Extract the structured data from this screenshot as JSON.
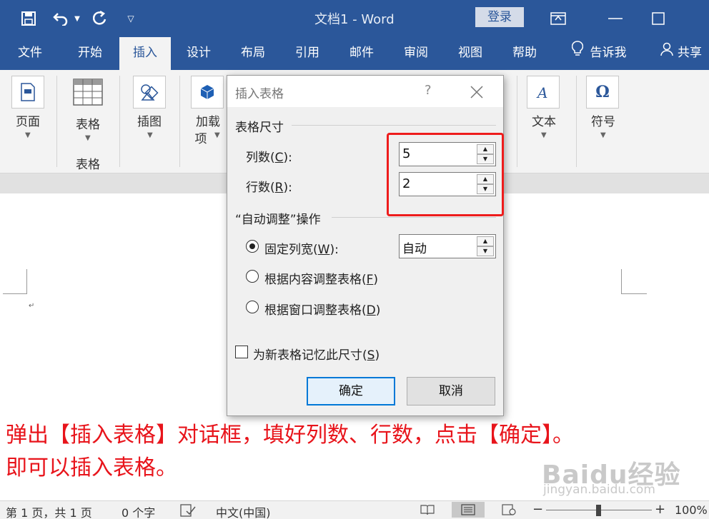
{
  "window": {
    "title": "文档1  -  Word",
    "login_label": "登录"
  },
  "tabs": [
    "文件",
    "开始",
    "插入",
    "设计",
    "布局",
    "引用",
    "邮件",
    "审阅",
    "视图",
    "帮助"
  ],
  "tell_me": "告诉我",
  "share": "共享",
  "ribbon": {
    "pages_label": "页面",
    "table_label": "表格",
    "table_group_label": "表格",
    "illustrations_label": "插图",
    "addins_label_1": "加载",
    "addins_label_2": "项",
    "text_label": "文本",
    "symbols_label": "符号"
  },
  "dialog": {
    "title": "插入表格",
    "help": "?",
    "size_section": "表格尺寸",
    "columns_label_pre": "列数(",
    "columns_key": "C",
    "columns_label_post": "):",
    "columns_value": "5",
    "rows_label_pre": "行数(",
    "rows_key": "R",
    "rows_label_post": "):",
    "rows_value": "2",
    "autofit_section": "“自动调整”操作",
    "fixed_label_pre": "固定列宽(",
    "fixed_key": "W",
    "fixed_label_post": "):",
    "fixed_value": "自动",
    "content_label_pre": "根据内容调整表格(",
    "content_key": "F",
    "content_label_post": ")",
    "window_label_pre": "根据窗口调整表格(",
    "window_key": "D",
    "window_label_post": ")",
    "remember_label_pre": "为新表格记忆此尺寸(",
    "remember_key": "S",
    "remember_label_post": ")",
    "ok_label": "确定",
    "cancel_label": "取消"
  },
  "caption": {
    "line1": "弹出【插入表格】对话框，填好列数、行数，点击【确定】。",
    "line2": "即可以插入表格。"
  },
  "watermark": {
    "big": "Baidu经验",
    "small": "jingyan.baidu.com"
  },
  "status": {
    "page": "第 1 页，共 1 页",
    "words": "0 个字",
    "language": "中文(中国)",
    "zoom": "100%"
  },
  "colors": {
    "accent": "#2b579a",
    "annotation": "#e8141b"
  }
}
